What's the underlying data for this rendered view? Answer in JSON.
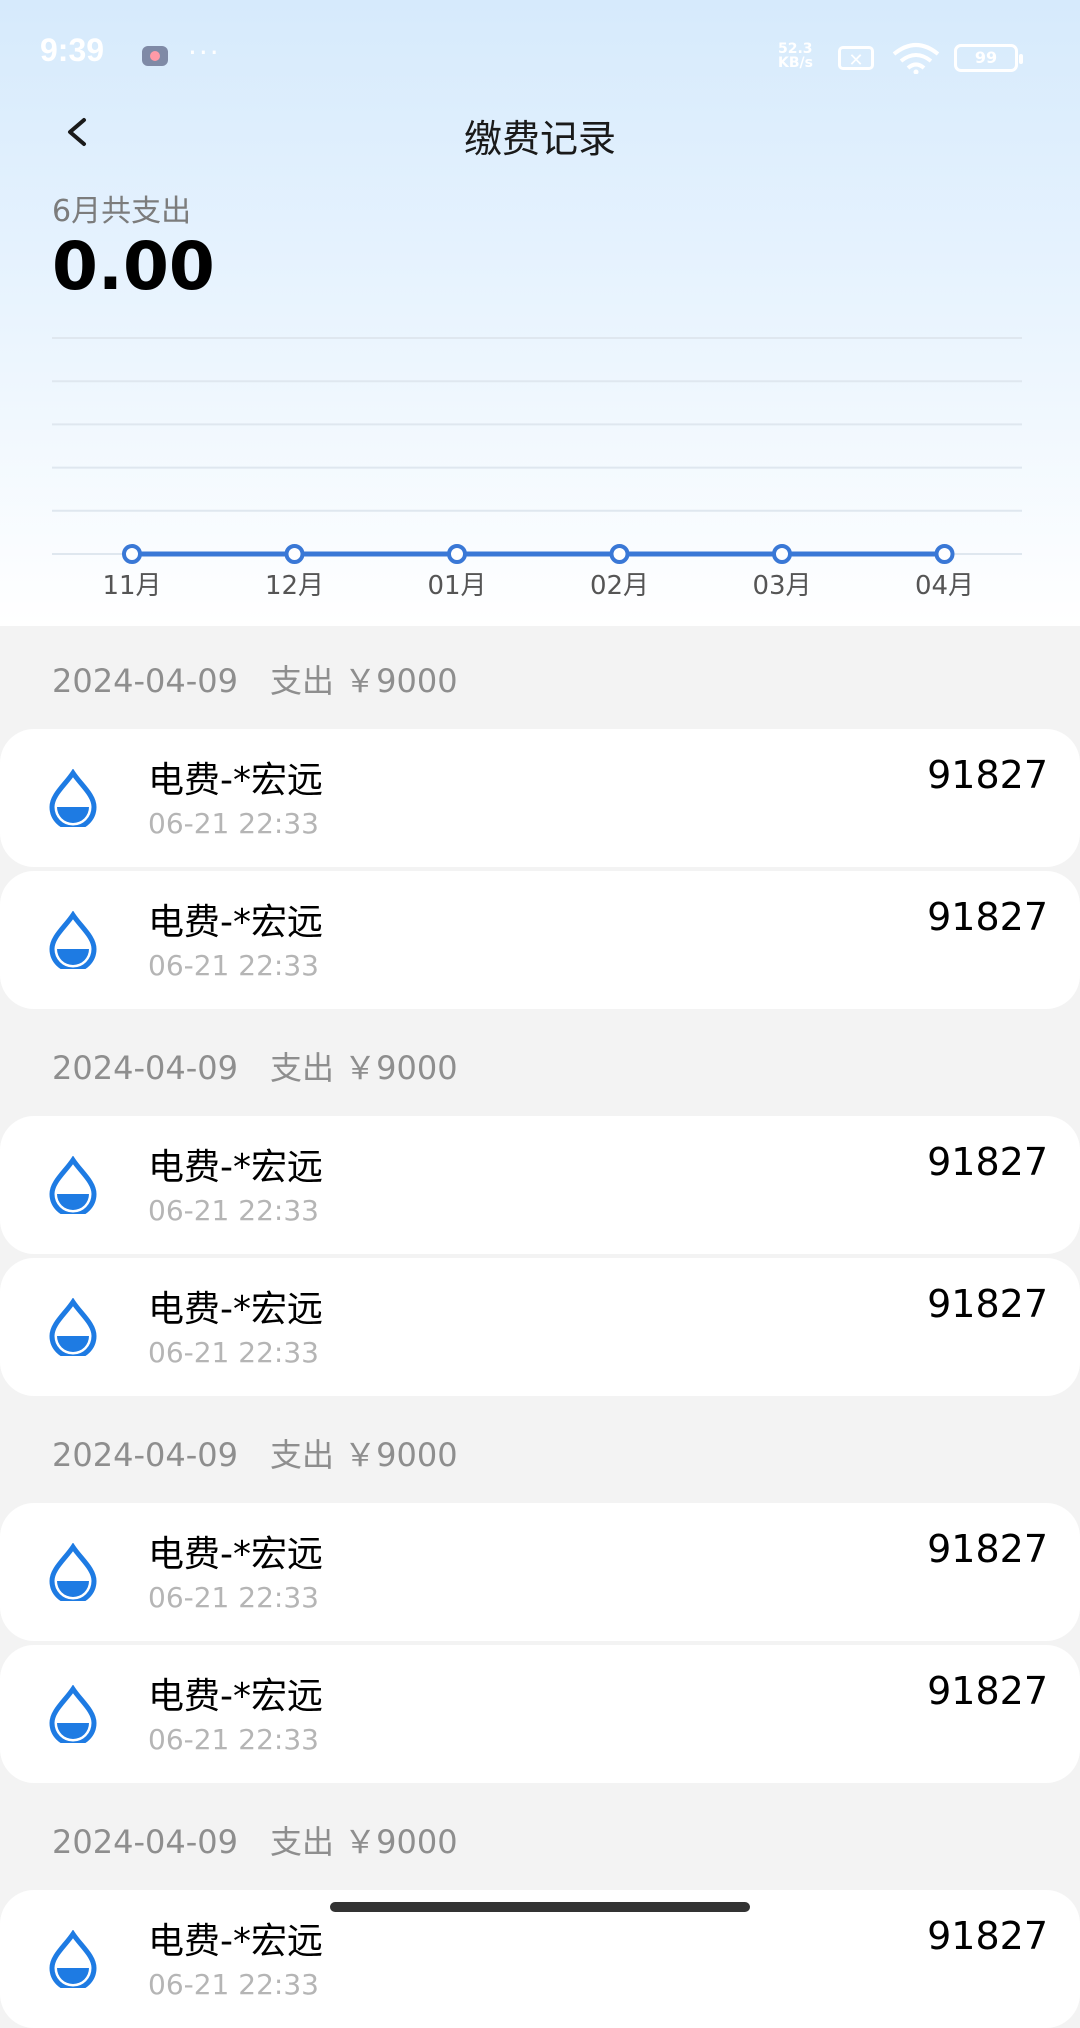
{
  "status_bar": {
    "time": "9:39",
    "dots": "···",
    "net_speed_top": "52.3",
    "net_speed_bottom": "KB/s",
    "sim": "✕",
    "battery": "99"
  },
  "header": {
    "title": "缴费记录"
  },
  "summary": {
    "label": "6月共支出",
    "total": "0.00"
  },
  "chart_data": {
    "type": "line",
    "categories": [
      "11月",
      "12月",
      "01月",
      "02月",
      "03月",
      "04月"
    ],
    "values": [
      0,
      0,
      0,
      0,
      0,
      0
    ],
    "grid": true,
    "colors": {
      "line": "#3a78d6",
      "grid": "#dfe7ef"
    }
  },
  "groups": [
    {
      "header": "2024-04-09　支出 ￥9000",
      "items": [
        {
          "name": "电费-*宏远",
          "time": "06-21 22:33",
          "amount": "91827"
        },
        {
          "name": "电费-*宏远",
          "time": "06-21 22:33",
          "amount": "91827"
        }
      ]
    },
    {
      "header": "2024-04-09　支出 ￥9000",
      "items": [
        {
          "name": "电费-*宏远",
          "time": "06-21 22:33",
          "amount": "91827"
        },
        {
          "name": "电费-*宏远",
          "time": "06-21 22:33",
          "amount": "91827"
        }
      ]
    },
    {
      "header": "2024-04-09　支出 ￥9000",
      "items": [
        {
          "name": "电费-*宏远",
          "time": "06-21 22:33",
          "amount": "91827"
        },
        {
          "name": "电费-*宏远",
          "time": "06-21 22:33",
          "amount": "91827"
        }
      ]
    },
    {
      "header": "2024-04-09　支出 ￥9000",
      "items": [
        {
          "name": "电费-*宏远",
          "time": "06-21 22:33",
          "amount": "91827"
        }
      ]
    }
  ],
  "icons": {
    "back": "chevron-left-icon",
    "item": "water-drop-icon"
  },
  "colors": {
    "accent": "#1e7be3"
  }
}
